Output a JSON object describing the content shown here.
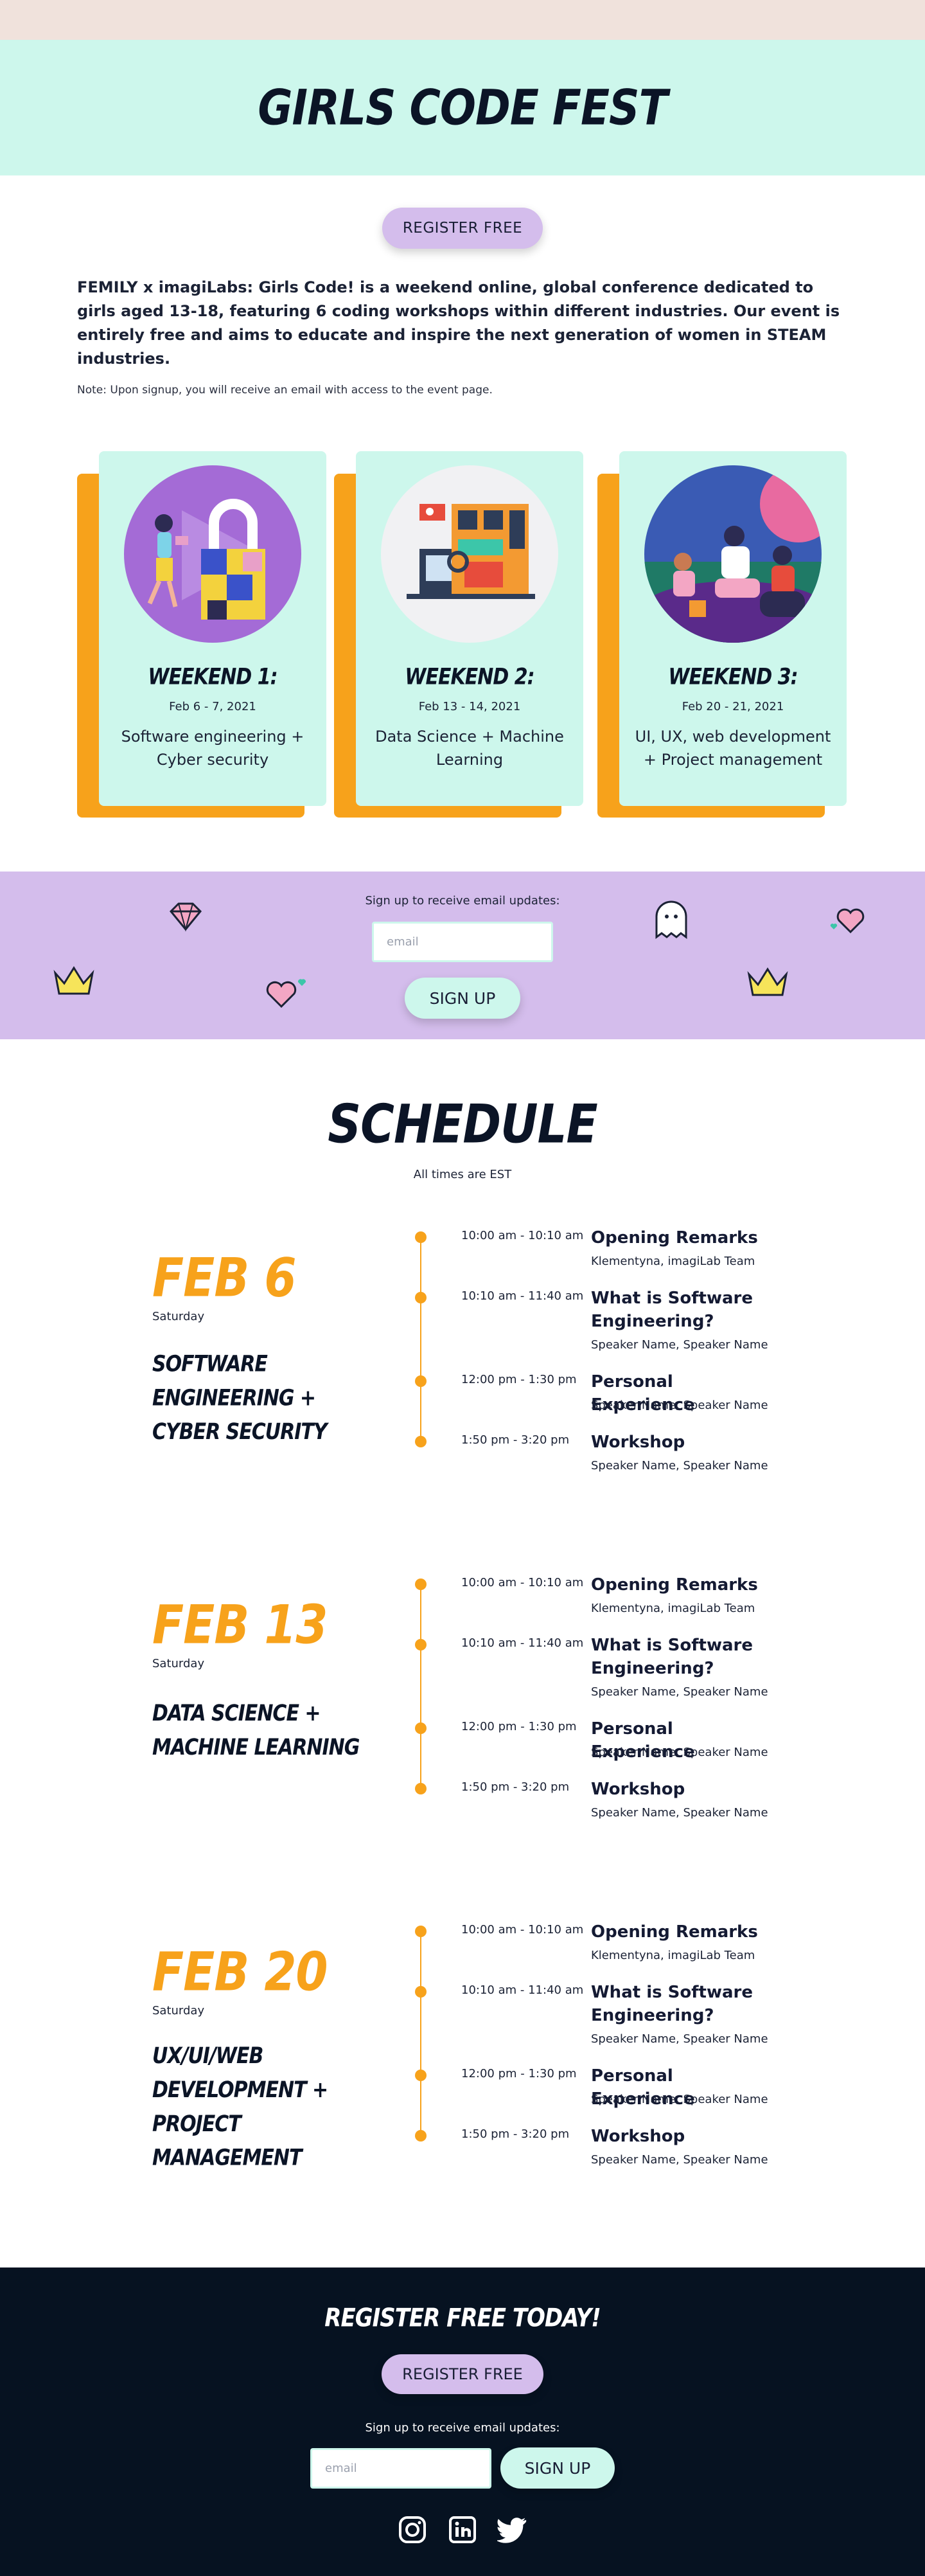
{
  "header": {
    "title": "GIRLS CODE FEST"
  },
  "register": {
    "label": "REGISTER FREE"
  },
  "intro": {
    "lead": "FEMILY x imagiLabs: Girls Code! is a weekend online, global conference dedicated to girls aged 13-18, featuring 6 coding workshops within different industries. Our event is entirely free and aims to educate and inspire the next generation of women in STEAM industries.",
    "note": "Note: Upon signup, you will receive an email with access to the event page."
  },
  "weekends": [
    {
      "title": "WEEKEND 1:",
      "date": "Feb 6 - 7, 2021",
      "topic": "Software engineering + Cyber security",
      "illustration": "security-lock-illustration"
    },
    {
      "title": "WEEKEND 2:",
      "date": "Feb 13 - 14, 2021",
      "topic": "Data Science + Machine Learning",
      "illustration": "data-dashboard-illustration"
    },
    {
      "title": "WEEKEND 3:",
      "date": "Feb 20 - 21, 2021",
      "topic": "UI, UX, web development + Project management",
      "illustration": "design-team-illustration"
    }
  ],
  "signup": {
    "label": "Sign up to receive email updates:",
    "placeholder": "email",
    "button": "SIGN UP"
  },
  "schedule": {
    "title": "SCHEDULE",
    "subtitle": "All times are EST",
    "days": [
      {
        "date": "FEB 6",
        "weekday": "Saturday",
        "track": "SOFTWARE ENGINEERING + CYBER SECURITY",
        "items": [
          {
            "time": "10:00 am - 10:10 am",
            "title": "Opening Remarks",
            "speaker": "Klementyna, imagiLab Team"
          },
          {
            "time": "10:10 am - 11:40 am",
            "title": "What is Software Engineering?",
            "speaker": "Speaker Name, Speaker Name"
          },
          {
            "time": "12:00 pm - 1:30 pm",
            "title": "Personal Experience",
            "speaker": "Speaker Name, Speaker Name"
          },
          {
            "time": "1:50 pm - 3:20 pm",
            "title": "Workshop",
            "speaker": "Speaker Name, Speaker Name"
          }
        ]
      },
      {
        "date": "FEB 13",
        "weekday": "Saturday",
        "track": "DATA SCIENCE + MACHINE LEARNING",
        "items": [
          {
            "time": "10:00 am - 10:10 am",
            "title": "Opening Remarks",
            "speaker": "Klementyna, imagiLab Team"
          },
          {
            "time": "10:10 am - 11:40 am",
            "title": "What is Software Engineering?",
            "speaker": "Speaker Name, Speaker Name"
          },
          {
            "time": "12:00 pm - 1:30 pm",
            "title": "Personal Experience",
            "speaker": "Speaker Name, Speaker Name"
          },
          {
            "time": "1:50 pm - 3:20 pm",
            "title": "Workshop",
            "speaker": "Speaker Name, Speaker Name"
          }
        ]
      },
      {
        "date": "FEB 20",
        "weekday": "Saturday",
        "track": "UX/UI/WEB DEVELOPMENT + PROJECT MANAGEMENT",
        "items": [
          {
            "time": "10:00 am - 10:10 am",
            "title": "Opening Remarks",
            "speaker": "Klementyna, imagiLab Team"
          },
          {
            "time": "10:10 am - 11:40 am",
            "title": "What is Software Engineering?",
            "speaker": "Speaker Name, Speaker Name"
          },
          {
            "time": "12:00 pm - 1:30 pm",
            "title": "Personal Experience",
            "speaker": "Speaker Name, Speaker Name"
          },
          {
            "time": "1:50 pm - 3:20 pm",
            "title": "Workshop",
            "speaker": "Speaker Name, Speaker Name"
          }
        ]
      }
    ]
  },
  "footer": {
    "title": "REGISTER FREE TODAY!",
    "register": "REGISTER FREE",
    "signup_label": "Sign up to receive email updates:",
    "placeholder": "email",
    "signup_button": "SIGN UP",
    "socials": [
      "instagram-icon",
      "linkedin-icon",
      "twitter-icon"
    ]
  },
  "colors": {
    "mint": "#cdf7ec",
    "lavender": "#d4bdec",
    "orange": "#f7a21b",
    "navy": "#061221",
    "peach": "#f0e2dc"
  }
}
